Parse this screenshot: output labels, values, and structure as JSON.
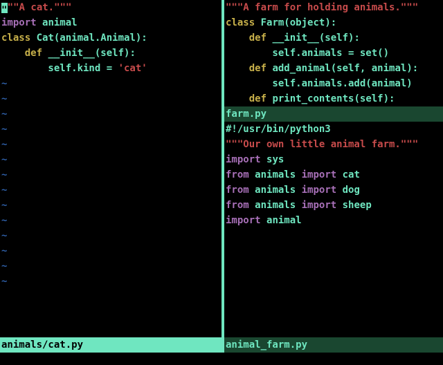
{
  "left": {
    "lines": [
      {
        "cursor": true,
        "segments": [
          {
            "cls": "c-str",
            "t": "\"\"A cat.\"\"\""
          }
        ]
      },
      {
        "segments": []
      },
      {
        "segments": [
          {
            "cls": "c-import",
            "t": "import"
          },
          {
            "cls": "",
            "t": " "
          },
          {
            "cls": "c-id",
            "t": "animal"
          }
        ]
      },
      {
        "segments": []
      },
      {
        "segments": [
          {
            "cls": "c-keyword",
            "t": "class"
          },
          {
            "cls": "",
            "t": " "
          },
          {
            "cls": "c-id",
            "t": "Cat(animal.Animal):"
          }
        ]
      },
      {
        "segments": []
      },
      {
        "segments": [
          {
            "cls": "",
            "t": "    "
          },
          {
            "cls": "c-keyword",
            "t": "def"
          },
          {
            "cls": "",
            "t": " "
          },
          {
            "cls": "c-func",
            "t": "__init__(self):"
          }
        ]
      },
      {
        "segments": [
          {
            "cls": "",
            "t": "        self.kind = "
          },
          {
            "cls": "c-str",
            "t": "'cat'"
          }
        ]
      }
    ],
    "tilde_count": 14,
    "status": "animals/cat.py"
  },
  "right_top": {
    "lines": [
      {
        "segments": [
          {
            "cls": "c-str",
            "t": "\"\"\"A farm for holding animals.\"\"\""
          }
        ]
      },
      {
        "segments": []
      },
      {
        "segments": [
          {
            "cls": "c-keyword",
            "t": "class"
          },
          {
            "cls": "",
            "t": " "
          },
          {
            "cls": "c-id",
            "t": "Farm("
          },
          {
            "cls": "c-builtin",
            "t": "object"
          },
          {
            "cls": "c-id",
            "t": "):"
          }
        ]
      },
      {
        "segments": []
      },
      {
        "segments": [
          {
            "cls": "",
            "t": "    "
          },
          {
            "cls": "c-keyword",
            "t": "def"
          },
          {
            "cls": "",
            "t": " "
          },
          {
            "cls": "c-func",
            "t": "__init__(self):"
          }
        ]
      },
      {
        "segments": [
          {
            "cls": "",
            "t": "        self.animals = "
          },
          {
            "cls": "c-builtin",
            "t": "set"
          },
          {
            "cls": "",
            "t": "()"
          }
        ]
      },
      {
        "segments": []
      },
      {
        "segments": [
          {
            "cls": "",
            "t": "    "
          },
          {
            "cls": "c-keyword",
            "t": "def"
          },
          {
            "cls": "",
            "t": " "
          },
          {
            "cls": "c-func",
            "t": "add_animal(self, animal):"
          }
        ]
      },
      {
        "segments": [
          {
            "cls": "",
            "t": "        self.animals.add(animal)"
          }
        ]
      },
      {
        "segments": []
      },
      {
        "segments": [
          {
            "cls": "",
            "t": "    "
          },
          {
            "cls": "c-keyword",
            "t": "def"
          },
          {
            "cls": "",
            "t": " "
          },
          {
            "cls": "c-func",
            "t": "print_contents(self):"
          }
        ]
      }
    ],
    "status": "farm.py"
  },
  "right_bottom": {
    "lines": [
      {
        "segments": [
          {
            "cls": "",
            "t": "#!/usr/bin/python3"
          }
        ]
      },
      {
        "segments": []
      },
      {
        "segments": [
          {
            "cls": "c-str",
            "t": "\"\"\"Our own little animal farm.\"\"\""
          }
        ]
      },
      {
        "segments": []
      },
      {
        "segments": [
          {
            "cls": "c-import",
            "t": "import"
          },
          {
            "cls": "",
            "t": " "
          },
          {
            "cls": "c-id",
            "t": "sys"
          }
        ]
      },
      {
        "segments": []
      },
      {
        "segments": [
          {
            "cls": "c-import",
            "t": "from"
          },
          {
            "cls": "",
            "t": " "
          },
          {
            "cls": "c-id",
            "t": "animals"
          },
          {
            "cls": "",
            "t": " "
          },
          {
            "cls": "c-import",
            "t": "import"
          },
          {
            "cls": "",
            "t": " "
          },
          {
            "cls": "c-id",
            "t": "cat"
          }
        ]
      },
      {
        "segments": [
          {
            "cls": "c-import",
            "t": "from"
          },
          {
            "cls": "",
            "t": " "
          },
          {
            "cls": "c-id",
            "t": "animals"
          },
          {
            "cls": "",
            "t": " "
          },
          {
            "cls": "c-import",
            "t": "import"
          },
          {
            "cls": "",
            "t": " "
          },
          {
            "cls": "c-id",
            "t": "dog"
          }
        ]
      },
      {
        "segments": [
          {
            "cls": "c-import",
            "t": "from"
          },
          {
            "cls": "",
            "t": " "
          },
          {
            "cls": "c-id",
            "t": "animals"
          },
          {
            "cls": "",
            "t": " "
          },
          {
            "cls": "c-import",
            "t": "import"
          },
          {
            "cls": "",
            "t": " "
          },
          {
            "cls": "c-id",
            "t": "sheep"
          }
        ]
      },
      {
        "segments": [
          {
            "cls": "c-import",
            "t": "import"
          },
          {
            "cls": "",
            "t": " "
          },
          {
            "cls": "c-id",
            "t": "animal"
          }
        ]
      }
    ],
    "status": "animal_farm.py"
  }
}
